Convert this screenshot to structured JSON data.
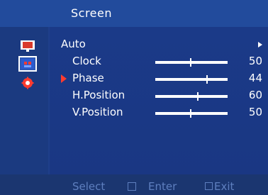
{
  "title": "Screen",
  "sidebar": {
    "icons": [
      {
        "name": "monitor-icon"
      },
      {
        "name": "picture-icon",
        "selected": true
      },
      {
        "name": "settings-icon"
      }
    ]
  },
  "menu": {
    "items": [
      {
        "label": "Auto",
        "type": "submenu"
      },
      {
        "label": "Clock",
        "value": "50"
      },
      {
        "label": "Phase",
        "value": "44",
        "selected": true
      },
      {
        "label": "H.Position",
        "value": "60"
      },
      {
        "label": "V.Position",
        "value": "50"
      }
    ]
  },
  "footer": {
    "select": "Select",
    "enter": "Enter",
    "exit": "Exit"
  },
  "colors": {
    "background": "#1f3f8a",
    "accent": "#ff3b2f",
    "text": "#ffffff",
    "footer_text": "#5e7fbf"
  }
}
